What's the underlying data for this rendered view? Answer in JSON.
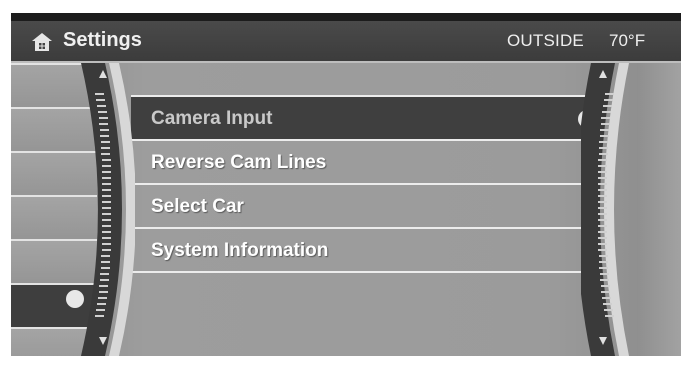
{
  "header": {
    "title": "Settings",
    "outside_label": "OUTSIDE",
    "temperature": "70°F"
  },
  "menu": {
    "items": [
      {
        "label": "Camera Input",
        "state": "selected"
      },
      {
        "label": "Reverse Cam Lines",
        "state": "normal"
      },
      {
        "label": "Select Car",
        "state": "normal"
      },
      {
        "label": "System Information",
        "state": "normal"
      }
    ]
  },
  "icons": {
    "home": "home-icon",
    "scroll_up": "triangle-up-icon",
    "scroll_down": "triangle-down-icon",
    "indicator": "dot-indicator-icon"
  },
  "colors": {
    "header_bg": "#444444",
    "body_bg": "#9b9b9b",
    "highlight_bg": "#3f3f3f",
    "text": "#ffffff",
    "dim_text": "#c9c9c9"
  }
}
